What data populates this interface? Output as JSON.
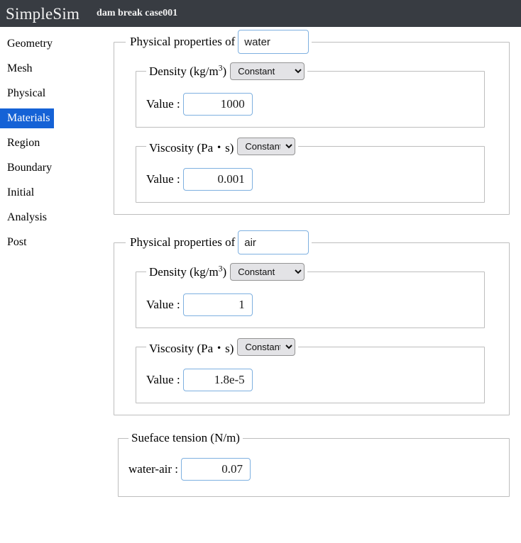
{
  "header": {
    "app_name": "SimpleSim",
    "case_name": "dam break case001"
  },
  "colors": {
    "header_bg": "#383c42",
    "active_nav_bg": "#1562d6",
    "input_border": "#7eb0e0",
    "fieldset_border": "#bdbdbd"
  },
  "sidebar": {
    "items": [
      {
        "label": "Geometry",
        "active": false
      },
      {
        "label": "Mesh",
        "active": false
      },
      {
        "label": "Physical",
        "active": false
      },
      {
        "label": "Materials",
        "active": true
      },
      {
        "label": "Region",
        "active": false
      },
      {
        "label": "Boundary",
        "active": false
      },
      {
        "label": "Initial",
        "active": false
      },
      {
        "label": "Analysis",
        "active": false
      },
      {
        "label": "Post",
        "active": false
      }
    ]
  },
  "main": {
    "material_legend_prefix": "Physical properties of",
    "density_label": "Density (kg/m",
    "density_label_sup": "3",
    "density_label_suffix": ")",
    "viscosity_label": "Viscosity (Pa・s)",
    "value_label": "Value :",
    "kind_options": [
      "Constant"
    ],
    "materials": [
      {
        "name": "water",
        "density": {
          "kind": "Constant",
          "value": "1000"
        },
        "viscosity": {
          "kind": "Constant",
          "value": "0.001"
        }
      },
      {
        "name": "air",
        "density": {
          "kind": "Constant",
          "value": "1"
        },
        "viscosity": {
          "kind": "Constant",
          "value": "1.8e-5"
        }
      }
    ],
    "surface_tension": {
      "legend": "Sueface tension (N/m)",
      "pair_label": "water-air :",
      "value": "0.07"
    }
  }
}
